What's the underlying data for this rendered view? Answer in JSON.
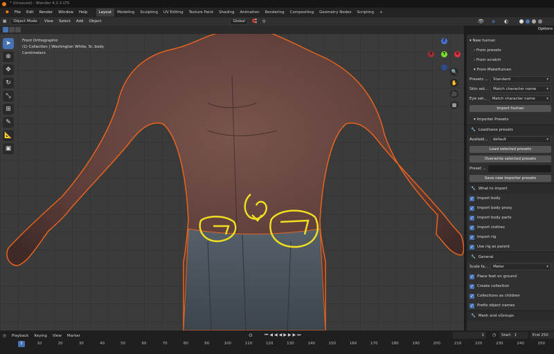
{
  "window": {
    "title": "* (Unsaved) - Blender 4.2.3 LTS"
  },
  "menu": [
    "File",
    "Edit",
    "Render",
    "Window",
    "Help"
  ],
  "workspaces": [
    "Layout",
    "Modeling",
    "Sculpting",
    "UV Editing",
    "Texture Paint",
    "Shading",
    "Animation",
    "Rendering",
    "Compositing",
    "Geometry Nodes",
    "Scripting",
    "+"
  ],
  "header": {
    "mode": "Object Mode",
    "view": "View",
    "select": "Select",
    "add": "Add",
    "object": "Object",
    "orientation": "Global",
    "options": "Options"
  },
  "viewport": {
    "view_name": "Front Orthographic",
    "collection": "(1) Collection | Washington White, Sr..body",
    "units": "Centimeters"
  },
  "gizmo": {
    "z": "Z",
    "x": "X",
    "y": "Y",
    "neg_x": "X"
  },
  "panel": {
    "new_human": "New human",
    "from_presets": "From presets",
    "from_scratch": "From scratch",
    "from_makehuman": "From MakeHuman",
    "presets_label": "Presets ...",
    "presets_value": "Standard",
    "skin_label": "Skin set...",
    "skin_value": "Match character name",
    "eye_label": "Eye set...",
    "eye_value": "Match character name",
    "import_human": "Import human",
    "importer_presets": "Importer Presets",
    "load_save": "Load/save presets",
    "avail_label": "Availabl...",
    "avail_value": "default",
    "load_selected": "Load selected presets",
    "overwrite_selected": "Overwrite selected presets",
    "preset_label": "Preset ...",
    "save_new": "Save new importer presets",
    "what_to_import": "What to import",
    "import_items": [
      "Import body",
      "Import body proxy",
      "Import body parts",
      "Import clothes",
      "Import rig",
      "Use rig as parent"
    ],
    "general": "General",
    "scale_label": "Scale fa...",
    "scale_value": "Meter",
    "general_items": [
      "Place feet on ground",
      "Create collection",
      "Collections as children",
      "Prefix object names"
    ],
    "mesh_vgroups": "Mesh and vGroups"
  },
  "timeline": {
    "playback": "Playback",
    "keying": "Keying",
    "view": "View",
    "marker": "Marker",
    "current_frame": "1",
    "start_label": "Start",
    "start": "1",
    "end_label": "End",
    "end": "250",
    "ticks": [
      "1",
      "10",
      "20",
      "30",
      "40",
      "50",
      "60",
      "70",
      "80",
      "90",
      "100",
      "110",
      "120",
      "130",
      "140",
      "150",
      "160",
      "170",
      "180",
      "190",
      "200",
      "210",
      "220",
      "230",
      "240",
      "250"
    ]
  },
  "colors": {
    "accent": "#4772b3",
    "selection_outline": "#e8641e",
    "annotation": "#f0e020",
    "skin": "#6e4a45",
    "jeans": "#4a5258"
  }
}
